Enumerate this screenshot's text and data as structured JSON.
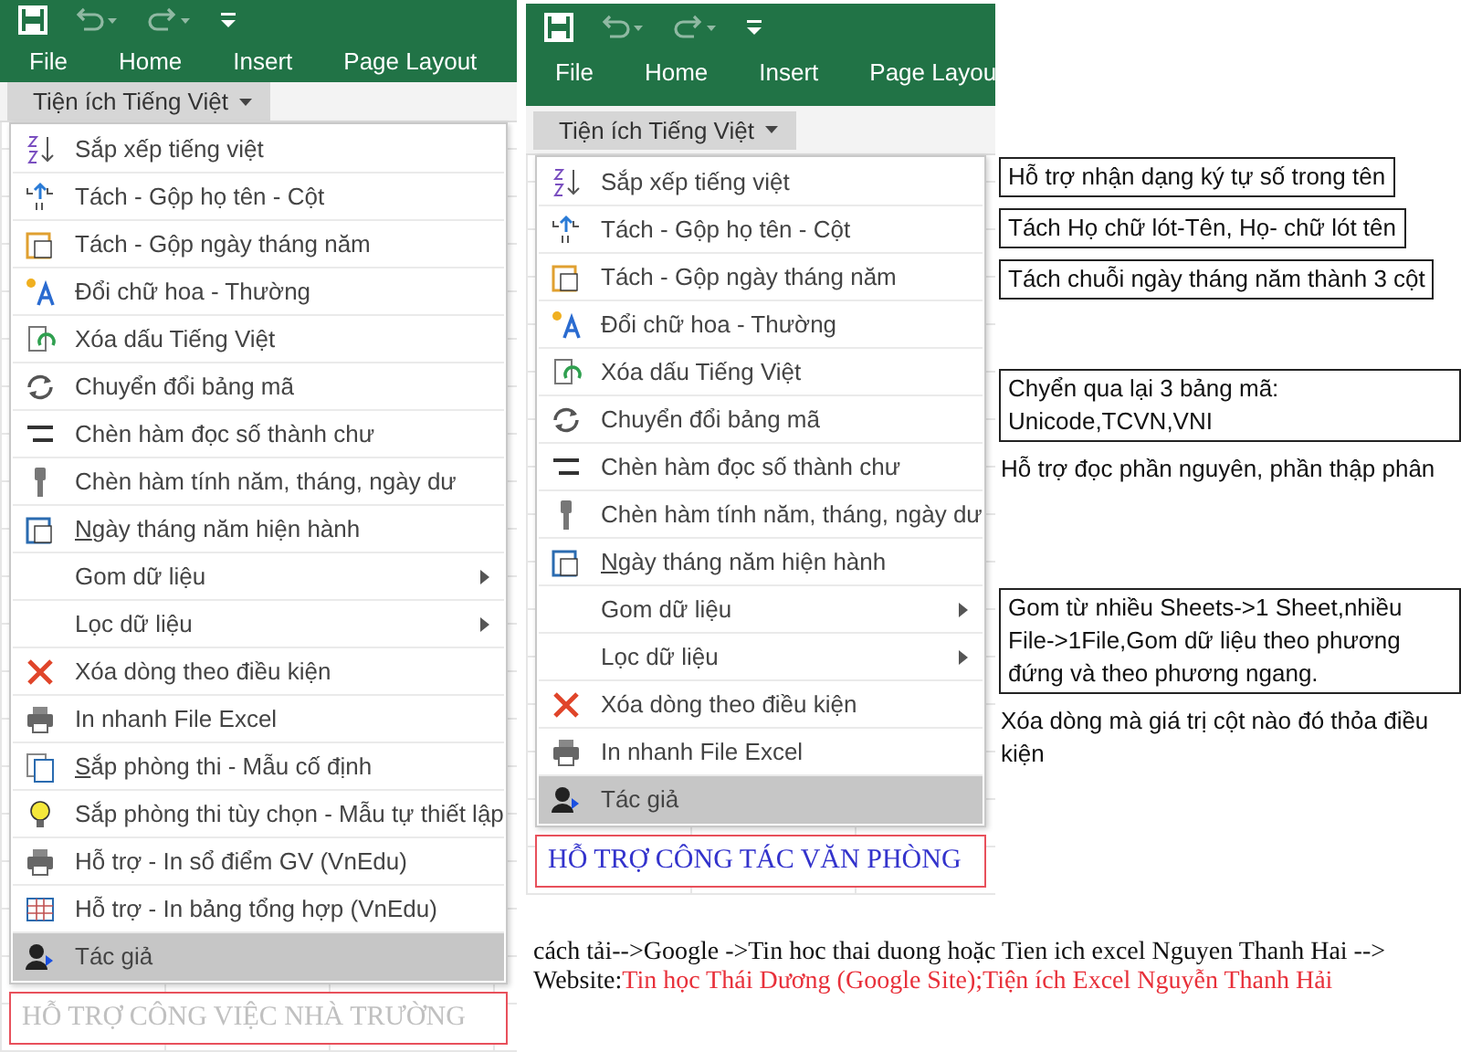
{
  "panels": [
    {
      "ribbon": {
        "tabs": [
          "File",
          "Home",
          "Insert",
          "Page Layout"
        ]
      },
      "dropdown": "Tiện ích Tiếng Việt",
      "items": [
        {
          "kind": "sort",
          "label": "Sắp xếp tiếng việt",
          "selected": false
        },
        {
          "kind": "split",
          "label": "Tách - Gộp họ tên - Cột",
          "selected": false
        },
        {
          "kind": "date",
          "label": "Tách - Gộp ngày tháng năm",
          "selected": false
        },
        {
          "kind": "case",
          "label": "Đổi chữ hoa - Thường",
          "selected": false
        },
        {
          "kind": "accent",
          "label": "Xóa dấu Tiếng Việt",
          "selected": false
        },
        {
          "kind": "convert",
          "label": "Chuyển đổi bảng mã",
          "selected": false
        },
        {
          "kind": "number",
          "label": "Chèn hàm đọc số thành chư",
          "selected": false
        },
        {
          "kind": "key",
          "label": "Chèn hàm tính năm, tháng, ngày dư",
          "selected": false
        },
        {
          "kind": "today",
          "label": "Ngày tháng năm hiện hành",
          "selected": false,
          "mnemonic": true
        },
        {
          "kind": "submenu",
          "label": "Gom dữ liệu",
          "selected": false
        },
        {
          "kind": "submenu",
          "label": "Lọc dữ liệu",
          "selected": false
        },
        {
          "kind": "delete",
          "label": "Xóa dòng theo điều kiện",
          "selected": false
        },
        {
          "kind": "print",
          "label": "In nhanh File Excel",
          "selected": false
        },
        {
          "kind": "rooms",
          "label": "Sắp phòng thi - Mẫu cố định",
          "selected": false,
          "mnemonic": true
        },
        {
          "kind": "bulb",
          "label": "Sắp phòng thi tùy chọn - Mẫu tự thiết lập",
          "selected": false
        },
        {
          "kind": "print",
          "label": "Hỗ trợ - In sổ điểm GV (VnEdu)",
          "selected": false
        },
        {
          "kind": "table",
          "label": "Hỗ trợ - In bảng tổng hợp (VnEdu)",
          "selected": false
        },
        {
          "kind": "author",
          "label": "Tác giả",
          "selected": true
        }
      ],
      "caption": {
        "text": "HỖ TRỢ CÔNG VIỆC NHÀ TRƯỜNG",
        "color": "#c0c0c0"
      }
    },
    {
      "ribbon": {
        "tabs": [
          "File",
          "Home",
          "Insert",
          "Page Layou"
        ]
      },
      "dropdown": "Tiện ích Tiếng Việt",
      "items": [
        {
          "kind": "sort",
          "label": "Sắp xếp tiếng việt",
          "selected": false
        },
        {
          "kind": "split",
          "label": "Tách - Gộp họ tên - Cột",
          "selected": false
        },
        {
          "kind": "date",
          "label": "Tách - Gộp ngày tháng năm",
          "selected": false
        },
        {
          "kind": "case",
          "label": "Đổi chữ hoa - Thường",
          "selected": false
        },
        {
          "kind": "accent",
          "label": "Xóa dấu Tiếng Việt",
          "selected": false
        },
        {
          "kind": "convert",
          "label": "Chuyển đổi bảng mã",
          "selected": false
        },
        {
          "kind": "number",
          "label": "Chèn hàm đọc số thành chư",
          "selected": false
        },
        {
          "kind": "key",
          "label": "Chèn hàm tính năm, tháng, ngày dư",
          "selected": false
        },
        {
          "kind": "today",
          "label": "Ngày tháng năm hiện hành",
          "selected": false,
          "mnemonic": true
        },
        {
          "kind": "submenu",
          "label": "Gom dữ liệu",
          "selected": false
        },
        {
          "kind": "submenu",
          "label": "Lọc dữ liệu",
          "selected": false
        },
        {
          "kind": "delete",
          "label": "Xóa dòng theo điều kiện",
          "selected": false
        },
        {
          "kind": "print",
          "label": "In nhanh File Excel",
          "selected": false
        },
        {
          "kind": "author",
          "label": "Tác giả",
          "selected": true
        }
      ],
      "caption": {
        "text": "HỖ TRỢ CÔNG TÁC VĂN PHÒNG",
        "color": "#3333cc"
      }
    }
  ],
  "notes": [
    {
      "kind": "boxed",
      "text": "Hỗ trợ nhận dạng ký tự số trong tên"
    },
    {
      "kind": "boxed",
      "text": "Tách Họ chữ lót-Tên, Họ- chữ lót tên"
    },
    {
      "kind": "boxed",
      "text": "Tách chuỗi ngày tháng năm thành 3 cột"
    },
    {
      "kind": "boxed",
      "text": "Chyển qua lại 3 bảng mã: Unicode,TCVN,VNI"
    },
    {
      "kind": "plain",
      "text": "Hỗ trợ đọc phần nguyên, phần thập phân"
    },
    {
      "kind": "boxed",
      "text": "Gom từ nhiều Sheets->1 Sheet,nhiều File->1File,Gom dữ liệu theo phương đứng và theo phương ngang."
    },
    {
      "kind": "plain",
      "text": "Xóa dòng mà giá trị cột nào đó thỏa điều kiện"
    }
  ],
  "download": {
    "text": "cách tải-->Google ->Tin hoc thai duong hoặc Tien ich excel Nguyen Thanh Hai --> Website:",
    "link": "Tin học Thái Dương (Google Site);Tiện ích Excel Nguyễn Thanh Hải"
  }
}
